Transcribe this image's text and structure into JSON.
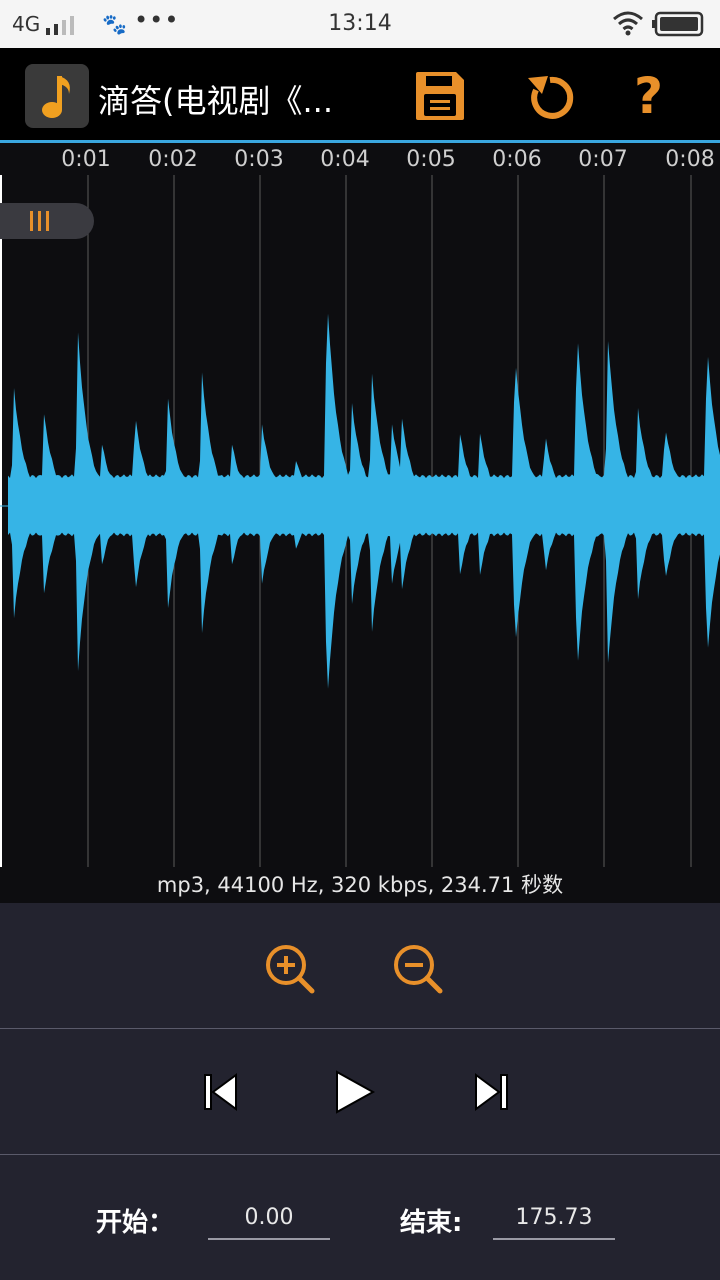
{
  "status_bar": {
    "network": "4G",
    "time": "13:14",
    "more": "•••"
  },
  "toolbar": {
    "title": "滴答(电视剧《...",
    "icons": [
      "music-note-icon",
      "save-icon",
      "undo-icon",
      "help-icon"
    ],
    "help_label": "?"
  },
  "timeline": {
    "ticks": [
      "0:01",
      "0:02",
      "0:03",
      "0:04",
      "0:05",
      "0:06",
      "0:07",
      "0:08"
    ]
  },
  "file_info": "mp3, 44100 Hz, 320 kbps, 234.71 秒数",
  "range": {
    "start_label": "开始：",
    "start_value": "0.00",
    "end_label": "结束:",
    "end_value": "175.73"
  },
  "colors": {
    "accent": "#e8902a",
    "wave": "#36b4e6",
    "panel": "#23232f"
  }
}
